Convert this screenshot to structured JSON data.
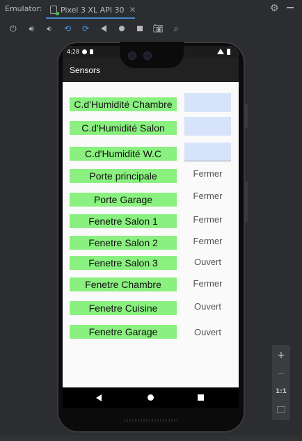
{
  "emulator": {
    "label": "Emulator:",
    "tab_title": "Pixel 3 XL API 30",
    "tab_close": "✕"
  },
  "phone": {
    "status_time": "4:28",
    "app_title": "Sensors"
  },
  "sensors": [
    {
      "name": "C.d'Humidité Chambre",
      "value": ""
    },
    {
      "name": "C.d'Humidité Salon",
      "value": ""
    },
    {
      "name": "C.d'Humidité W.C",
      "value": ""
    },
    {
      "name": "Porte principale",
      "value": "Fermer"
    },
    {
      "name": "Porte Garage",
      "value": "Fermer"
    },
    {
      "name": "Fenetre Salon 1",
      "value": "Fermer"
    },
    {
      "name": "Fenetre Salon 2",
      "value": "Fermer"
    },
    {
      "name": "Fenetre Salon 3",
      "value": "Ouvert"
    },
    {
      "name": "Fenetre Chambre",
      "value": "Fermer"
    },
    {
      "name": "Fenetre Cuisine",
      "value": "Ouvert"
    },
    {
      "name": "Fenetre Garage",
      "value": "Ouvert"
    }
  ],
  "zoom_panel": {
    "zoom_in": "+",
    "zoom_out": "−",
    "actual_size": "1:1"
  },
  "colors": {
    "label_bg": "#8af07f",
    "input_bg": "#d6e3fb",
    "app_bar": "#212121"
  }
}
